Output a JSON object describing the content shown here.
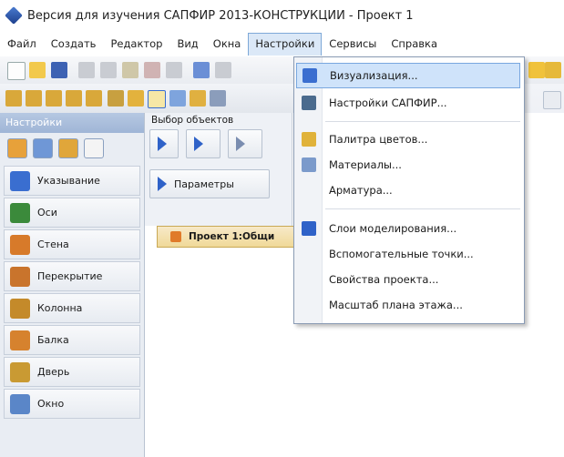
{
  "window": {
    "title": "Версия для изучения САПФИР 2013-КОНСТРУКЦИИ - Проект 1"
  },
  "menubar": {
    "items": [
      {
        "label": "Файл"
      },
      {
        "label": "Создать"
      },
      {
        "label": "Редактор"
      },
      {
        "label": "Вид"
      },
      {
        "label": "Окна"
      },
      {
        "label": "Настройки",
        "active": true
      },
      {
        "label": "Сервисы"
      },
      {
        "label": "Справка"
      }
    ]
  },
  "left_panel": {
    "header": "Настройки",
    "items": [
      {
        "label": "Указывание",
        "icon": "pointer-icon",
        "color": "#3a6ed0"
      },
      {
        "label": "Оси",
        "icon": "grid-axes-icon",
        "color": "#3b8a3b"
      },
      {
        "label": "Стена",
        "icon": "wall-icon",
        "color": "#d77a2a"
      },
      {
        "label": "Перекрытие",
        "icon": "slab-icon",
        "color": "#c9742c"
      },
      {
        "label": "Колонна",
        "icon": "column-icon",
        "color": "#c48a2a"
      },
      {
        "label": "Балка",
        "icon": "beam-icon",
        "color": "#d6822e"
      },
      {
        "label": "Дверь",
        "icon": "door-icon",
        "color": "#c99a33"
      },
      {
        "label": "Окно",
        "icon": "window-icon",
        "color": "#5a86c8"
      }
    ]
  },
  "object_panel": {
    "label": "Выбор объектов",
    "params_button": "Параметры"
  },
  "document_tab": {
    "label": "Проект 1:Общи"
  },
  "dropdown": {
    "items": [
      {
        "label": "Визуализация...",
        "icon": "visualization-icon",
        "highlighted": true
      },
      {
        "label": "Настройки САПФИР...",
        "icon": "settings-icon"
      },
      {
        "label": "Палитра цветов...",
        "icon": "palette-icon",
        "separator_before": true
      },
      {
        "label": "Материалы...",
        "icon": "materials-icon"
      },
      {
        "label": "Арматура...",
        "icon": ""
      },
      {
        "label": "Слои моделирования...",
        "icon": "layers-icon",
        "separator_before": true
      },
      {
        "label": "Вспомогательные точки...",
        "icon": ""
      },
      {
        "label": "Свойства проекта...",
        "icon": ""
      },
      {
        "label": "Масштаб плана этажа...",
        "icon": ""
      }
    ]
  },
  "colors": {
    "accent": "#cfe3fa",
    "accent_border": "#79a7df",
    "panel_header": "#9fb5d6"
  }
}
